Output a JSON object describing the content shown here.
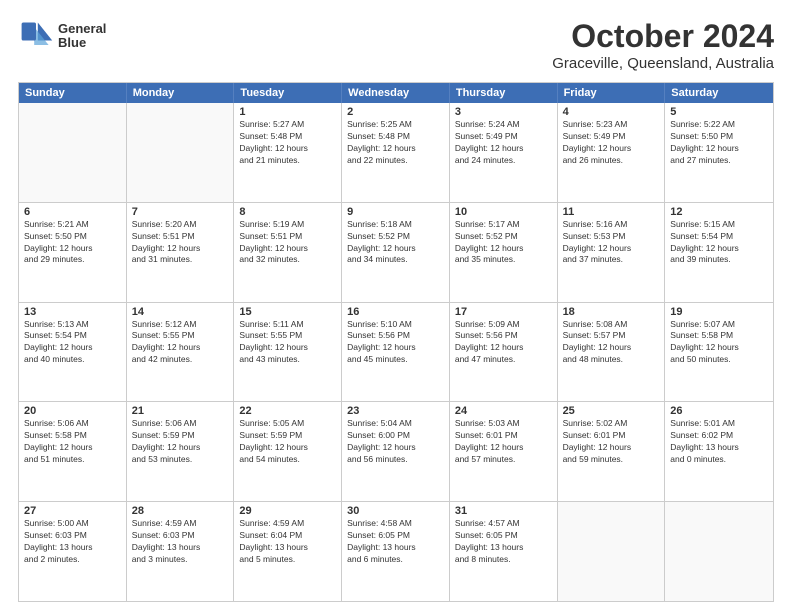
{
  "header": {
    "logo_line1": "General",
    "logo_line2": "Blue",
    "month": "October 2024",
    "location": "Graceville, Queensland, Australia"
  },
  "weekdays": [
    "Sunday",
    "Monday",
    "Tuesday",
    "Wednesday",
    "Thursday",
    "Friday",
    "Saturday"
  ],
  "rows": [
    [
      {
        "day": "",
        "info": ""
      },
      {
        "day": "",
        "info": ""
      },
      {
        "day": "1",
        "info": "Sunrise: 5:27 AM\nSunset: 5:48 PM\nDaylight: 12 hours\nand 21 minutes."
      },
      {
        "day": "2",
        "info": "Sunrise: 5:25 AM\nSunset: 5:48 PM\nDaylight: 12 hours\nand 22 minutes."
      },
      {
        "day": "3",
        "info": "Sunrise: 5:24 AM\nSunset: 5:49 PM\nDaylight: 12 hours\nand 24 minutes."
      },
      {
        "day": "4",
        "info": "Sunrise: 5:23 AM\nSunset: 5:49 PM\nDaylight: 12 hours\nand 26 minutes."
      },
      {
        "day": "5",
        "info": "Sunrise: 5:22 AM\nSunset: 5:50 PM\nDaylight: 12 hours\nand 27 minutes."
      }
    ],
    [
      {
        "day": "6",
        "info": "Sunrise: 5:21 AM\nSunset: 5:50 PM\nDaylight: 12 hours\nand 29 minutes."
      },
      {
        "day": "7",
        "info": "Sunrise: 5:20 AM\nSunset: 5:51 PM\nDaylight: 12 hours\nand 31 minutes."
      },
      {
        "day": "8",
        "info": "Sunrise: 5:19 AM\nSunset: 5:51 PM\nDaylight: 12 hours\nand 32 minutes."
      },
      {
        "day": "9",
        "info": "Sunrise: 5:18 AM\nSunset: 5:52 PM\nDaylight: 12 hours\nand 34 minutes."
      },
      {
        "day": "10",
        "info": "Sunrise: 5:17 AM\nSunset: 5:52 PM\nDaylight: 12 hours\nand 35 minutes."
      },
      {
        "day": "11",
        "info": "Sunrise: 5:16 AM\nSunset: 5:53 PM\nDaylight: 12 hours\nand 37 minutes."
      },
      {
        "day": "12",
        "info": "Sunrise: 5:15 AM\nSunset: 5:54 PM\nDaylight: 12 hours\nand 39 minutes."
      }
    ],
    [
      {
        "day": "13",
        "info": "Sunrise: 5:13 AM\nSunset: 5:54 PM\nDaylight: 12 hours\nand 40 minutes."
      },
      {
        "day": "14",
        "info": "Sunrise: 5:12 AM\nSunset: 5:55 PM\nDaylight: 12 hours\nand 42 minutes."
      },
      {
        "day": "15",
        "info": "Sunrise: 5:11 AM\nSunset: 5:55 PM\nDaylight: 12 hours\nand 43 minutes."
      },
      {
        "day": "16",
        "info": "Sunrise: 5:10 AM\nSunset: 5:56 PM\nDaylight: 12 hours\nand 45 minutes."
      },
      {
        "day": "17",
        "info": "Sunrise: 5:09 AM\nSunset: 5:56 PM\nDaylight: 12 hours\nand 47 minutes."
      },
      {
        "day": "18",
        "info": "Sunrise: 5:08 AM\nSunset: 5:57 PM\nDaylight: 12 hours\nand 48 minutes."
      },
      {
        "day": "19",
        "info": "Sunrise: 5:07 AM\nSunset: 5:58 PM\nDaylight: 12 hours\nand 50 minutes."
      }
    ],
    [
      {
        "day": "20",
        "info": "Sunrise: 5:06 AM\nSunset: 5:58 PM\nDaylight: 12 hours\nand 51 minutes."
      },
      {
        "day": "21",
        "info": "Sunrise: 5:06 AM\nSunset: 5:59 PM\nDaylight: 12 hours\nand 53 minutes."
      },
      {
        "day": "22",
        "info": "Sunrise: 5:05 AM\nSunset: 5:59 PM\nDaylight: 12 hours\nand 54 minutes."
      },
      {
        "day": "23",
        "info": "Sunrise: 5:04 AM\nSunset: 6:00 PM\nDaylight: 12 hours\nand 56 minutes."
      },
      {
        "day": "24",
        "info": "Sunrise: 5:03 AM\nSunset: 6:01 PM\nDaylight: 12 hours\nand 57 minutes."
      },
      {
        "day": "25",
        "info": "Sunrise: 5:02 AM\nSunset: 6:01 PM\nDaylight: 12 hours\nand 59 minutes."
      },
      {
        "day": "26",
        "info": "Sunrise: 5:01 AM\nSunset: 6:02 PM\nDaylight: 13 hours\nand 0 minutes."
      }
    ],
    [
      {
        "day": "27",
        "info": "Sunrise: 5:00 AM\nSunset: 6:03 PM\nDaylight: 13 hours\nand 2 minutes."
      },
      {
        "day": "28",
        "info": "Sunrise: 4:59 AM\nSunset: 6:03 PM\nDaylight: 13 hours\nand 3 minutes."
      },
      {
        "day": "29",
        "info": "Sunrise: 4:59 AM\nSunset: 6:04 PM\nDaylight: 13 hours\nand 5 minutes."
      },
      {
        "day": "30",
        "info": "Sunrise: 4:58 AM\nSunset: 6:05 PM\nDaylight: 13 hours\nand 6 minutes."
      },
      {
        "day": "31",
        "info": "Sunrise: 4:57 AM\nSunset: 6:05 PM\nDaylight: 13 hours\nand 8 minutes."
      },
      {
        "day": "",
        "info": ""
      },
      {
        "day": "",
        "info": ""
      }
    ]
  ]
}
